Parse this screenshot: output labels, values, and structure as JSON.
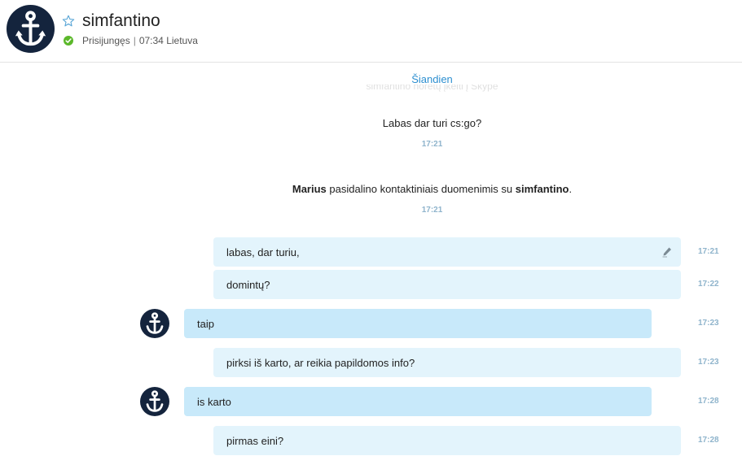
{
  "header": {
    "contact_name": "simfantino",
    "status": "Prisijungęs",
    "separator": "|",
    "local_time": "07:34 Lietuva",
    "status_color": "#5cb82b",
    "avatar_icon": "anchor-icon",
    "favorite_icon": "star-icon"
  },
  "conversation": {
    "date_label": "Šiandien",
    "faded_notice": "simfantino norėtų įkelti į Skype",
    "first_message": {
      "text": "Labas dar turi cs:go?",
      "time": "17:21"
    },
    "share_notice": {
      "actor": "Marius",
      "text": "pasidalino kontaktiniais duomenimis su",
      "target": "simfantino",
      "punct": ".",
      "time": "17:21"
    },
    "messages": [
      {
        "direction": "out",
        "text": "labas, dar turiu,",
        "time": "17:21",
        "edited": true
      },
      {
        "direction": "out",
        "text": "domintų?",
        "time": "17:22"
      },
      {
        "direction": "in",
        "text": "taip",
        "time": "17:23"
      },
      {
        "direction": "out",
        "text": "pirksi iš karto, ar reikia papildomos info?",
        "time": "17:23"
      },
      {
        "direction": "in",
        "text": "is karto",
        "time": "17:28"
      },
      {
        "direction": "out",
        "text": "pirmas eini?",
        "time": "17:28"
      }
    ]
  },
  "colors": {
    "outgoing_bubble": "#e3f4fc",
    "incoming_bubble": "#c8e9fa",
    "avatar_bg": "#14243d",
    "accent": "#2d8fd0"
  }
}
